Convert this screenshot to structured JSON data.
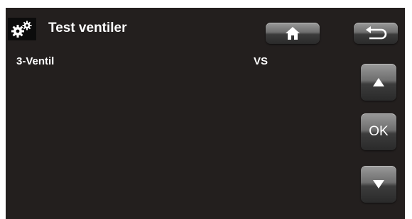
{
  "header": {
    "title": "Test ventiler",
    "icon": "gears-icon"
  },
  "toolbar": {
    "home_icon": "home-icon",
    "back_icon": "back-arrow-icon"
  },
  "rows": [
    {
      "label": "3-Ventil",
      "value": "VS"
    }
  ],
  "side_controls": {
    "up_icon": "up-arrow-icon",
    "ok_label": "OK",
    "down_icon": "down-arrow-icon"
  },
  "colors": {
    "background": "#231f1e",
    "text": "#ffffff",
    "button": "#5a5a5a"
  }
}
